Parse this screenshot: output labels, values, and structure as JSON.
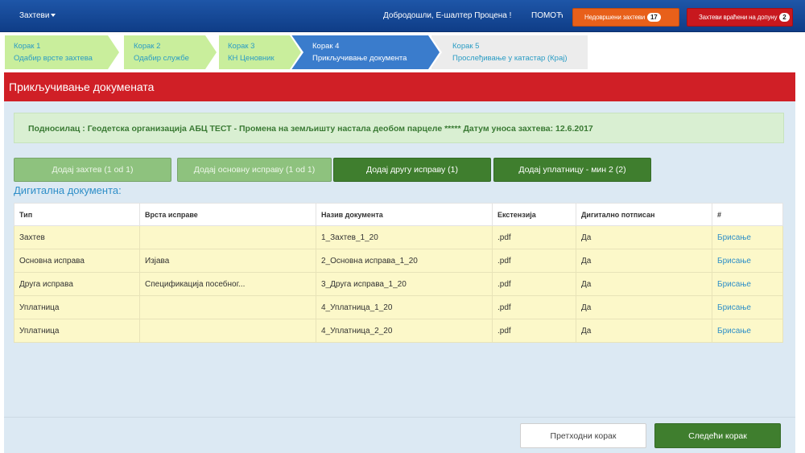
{
  "topbar": {
    "menu_label": "Захтеви",
    "welcome": "Добродошли, Е-шалтер Процена !",
    "help": "ПОМОЋ",
    "pending_label": "Недовршени захтеви",
    "pending_count": "17",
    "returned_label": "Захтеви враћени на допуну",
    "returned_count": "2"
  },
  "steps": [
    {
      "num": "Корак 1",
      "label": "Одабир врсте захтева"
    },
    {
      "num": "Корак 2",
      "label": "Одабир службе"
    },
    {
      "num": "Корак 3",
      "label": "КН Ценовник"
    },
    {
      "num": "Корак 4",
      "label": "Прикључивање документа"
    },
    {
      "num": "Корак 5",
      "label": "Прослеђивање у катастар (Крај)"
    }
  ],
  "panel": {
    "title": "Прикључивање докумената",
    "info": "Подносилац : Геодетска организација АБЦ ТЕСТ - Промена на земљишту настала деобом парцеле ***** Датум уноса захтева: 12.6.2017"
  },
  "actions": {
    "add_request": "Додај захтев (1 od 1)",
    "add_basic_doc": "Додај основну исправу (1 od 1)",
    "add_other_doc": "Додај другу исправу (1)",
    "add_payment": "Додај уплатницу - мин 2 (2)"
  },
  "section_title": "Дигитална документа:",
  "table": {
    "headers": [
      "Тип",
      "Врста исправе",
      "Назив документа",
      "Екстензија",
      "Дигитално потписан",
      "#"
    ],
    "rows": [
      [
        "Захтев",
        "",
        "1_Захтев_1_20",
        ".pdf",
        "Да",
        "Брисање"
      ],
      [
        "Основна исправа",
        "Изјава",
        "2_Основна исправа_1_20",
        ".pdf",
        "Да",
        "Брисање"
      ],
      [
        "Друга исправа",
        "Спецификација посебног...",
        "3_Друга исправа_1_20",
        ".pdf",
        "Да",
        "Брисање"
      ],
      [
        "Уплатница",
        "",
        "4_Уплатница_1_20",
        ".pdf",
        "Да",
        "Брисање"
      ],
      [
        "Уплатница",
        "",
        "4_Уплатница_2_20",
        ".pdf",
        "Да",
        "Брисање"
      ]
    ]
  },
  "footer": {
    "prev": "Претходни корак",
    "next": "Следећи корак"
  },
  "colors": {
    "topbar": "#1e56a8",
    "step_done": "#c9ee9c",
    "step_active": "#3a7ccc",
    "header_red": "#d01f26",
    "button_green": "#3f7e2e",
    "row_yellow": "#fcf8c9",
    "link_blue": "#2f8fc8"
  }
}
